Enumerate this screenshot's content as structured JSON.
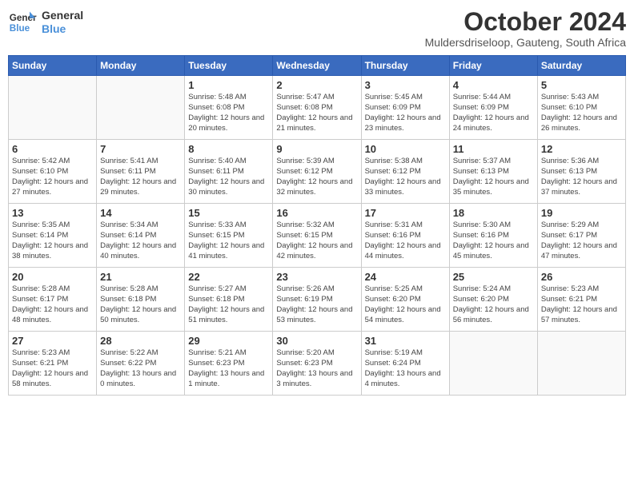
{
  "logo": {
    "line1": "General",
    "line2": "Blue"
  },
  "title": "October 2024",
  "subtitle": "Muldersdriseloop, Gauteng, South Africa",
  "days_of_week": [
    "Sunday",
    "Monday",
    "Tuesday",
    "Wednesday",
    "Thursday",
    "Friday",
    "Saturday"
  ],
  "weeks": [
    [
      {
        "num": "",
        "info": ""
      },
      {
        "num": "",
        "info": ""
      },
      {
        "num": "1",
        "info": "Sunrise: 5:48 AM\nSunset: 6:08 PM\nDaylight: 12 hours and 20 minutes."
      },
      {
        "num": "2",
        "info": "Sunrise: 5:47 AM\nSunset: 6:08 PM\nDaylight: 12 hours and 21 minutes."
      },
      {
        "num": "3",
        "info": "Sunrise: 5:45 AM\nSunset: 6:09 PM\nDaylight: 12 hours and 23 minutes."
      },
      {
        "num": "4",
        "info": "Sunrise: 5:44 AM\nSunset: 6:09 PM\nDaylight: 12 hours and 24 minutes."
      },
      {
        "num": "5",
        "info": "Sunrise: 5:43 AM\nSunset: 6:10 PM\nDaylight: 12 hours and 26 minutes."
      }
    ],
    [
      {
        "num": "6",
        "info": "Sunrise: 5:42 AM\nSunset: 6:10 PM\nDaylight: 12 hours and 27 minutes."
      },
      {
        "num": "7",
        "info": "Sunrise: 5:41 AM\nSunset: 6:11 PM\nDaylight: 12 hours and 29 minutes."
      },
      {
        "num": "8",
        "info": "Sunrise: 5:40 AM\nSunset: 6:11 PM\nDaylight: 12 hours and 30 minutes."
      },
      {
        "num": "9",
        "info": "Sunrise: 5:39 AM\nSunset: 6:12 PM\nDaylight: 12 hours and 32 minutes."
      },
      {
        "num": "10",
        "info": "Sunrise: 5:38 AM\nSunset: 6:12 PM\nDaylight: 12 hours and 33 minutes."
      },
      {
        "num": "11",
        "info": "Sunrise: 5:37 AM\nSunset: 6:13 PM\nDaylight: 12 hours and 35 minutes."
      },
      {
        "num": "12",
        "info": "Sunrise: 5:36 AM\nSunset: 6:13 PM\nDaylight: 12 hours and 37 minutes."
      }
    ],
    [
      {
        "num": "13",
        "info": "Sunrise: 5:35 AM\nSunset: 6:14 PM\nDaylight: 12 hours and 38 minutes."
      },
      {
        "num": "14",
        "info": "Sunrise: 5:34 AM\nSunset: 6:14 PM\nDaylight: 12 hours and 40 minutes."
      },
      {
        "num": "15",
        "info": "Sunrise: 5:33 AM\nSunset: 6:15 PM\nDaylight: 12 hours and 41 minutes."
      },
      {
        "num": "16",
        "info": "Sunrise: 5:32 AM\nSunset: 6:15 PM\nDaylight: 12 hours and 42 minutes."
      },
      {
        "num": "17",
        "info": "Sunrise: 5:31 AM\nSunset: 6:16 PM\nDaylight: 12 hours and 44 minutes."
      },
      {
        "num": "18",
        "info": "Sunrise: 5:30 AM\nSunset: 6:16 PM\nDaylight: 12 hours and 45 minutes."
      },
      {
        "num": "19",
        "info": "Sunrise: 5:29 AM\nSunset: 6:17 PM\nDaylight: 12 hours and 47 minutes."
      }
    ],
    [
      {
        "num": "20",
        "info": "Sunrise: 5:28 AM\nSunset: 6:17 PM\nDaylight: 12 hours and 48 minutes."
      },
      {
        "num": "21",
        "info": "Sunrise: 5:28 AM\nSunset: 6:18 PM\nDaylight: 12 hours and 50 minutes."
      },
      {
        "num": "22",
        "info": "Sunrise: 5:27 AM\nSunset: 6:18 PM\nDaylight: 12 hours and 51 minutes."
      },
      {
        "num": "23",
        "info": "Sunrise: 5:26 AM\nSunset: 6:19 PM\nDaylight: 12 hours and 53 minutes."
      },
      {
        "num": "24",
        "info": "Sunrise: 5:25 AM\nSunset: 6:20 PM\nDaylight: 12 hours and 54 minutes."
      },
      {
        "num": "25",
        "info": "Sunrise: 5:24 AM\nSunset: 6:20 PM\nDaylight: 12 hours and 56 minutes."
      },
      {
        "num": "26",
        "info": "Sunrise: 5:23 AM\nSunset: 6:21 PM\nDaylight: 12 hours and 57 minutes."
      }
    ],
    [
      {
        "num": "27",
        "info": "Sunrise: 5:23 AM\nSunset: 6:21 PM\nDaylight: 12 hours and 58 minutes."
      },
      {
        "num": "28",
        "info": "Sunrise: 5:22 AM\nSunset: 6:22 PM\nDaylight: 13 hours and 0 minutes."
      },
      {
        "num": "29",
        "info": "Sunrise: 5:21 AM\nSunset: 6:23 PM\nDaylight: 13 hours and 1 minute."
      },
      {
        "num": "30",
        "info": "Sunrise: 5:20 AM\nSunset: 6:23 PM\nDaylight: 13 hours and 3 minutes."
      },
      {
        "num": "31",
        "info": "Sunrise: 5:19 AM\nSunset: 6:24 PM\nDaylight: 13 hours and 4 minutes."
      },
      {
        "num": "",
        "info": ""
      },
      {
        "num": "",
        "info": ""
      }
    ]
  ]
}
